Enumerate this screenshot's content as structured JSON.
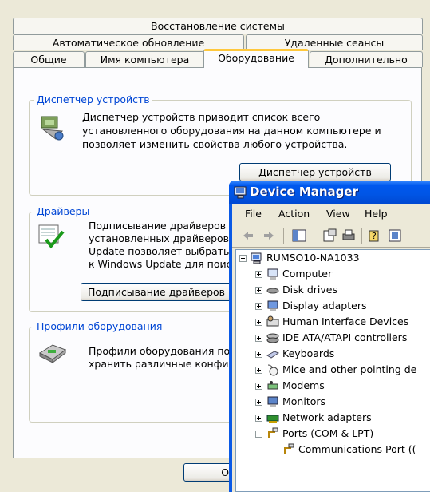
{
  "tabs_row1": [
    "Восстановление системы"
  ],
  "tabs_row2": [
    "Автоматическое обновление",
    "Удаленные сеансы"
  ],
  "tabs_row3": [
    "Общие",
    "Имя компьютера",
    "Оборудование",
    "Дополнительно"
  ],
  "device_manager_group": {
    "title": "Диспетчер устройств",
    "description": [
      "Диспетчер устройств приводит список всего",
      "установленного оборудования на данном компьютере и",
      "позволяет изменить свойства любого устройства."
    ],
    "button": "Диспетчер устройств"
  },
  "drivers_group": {
    "title": "Драйверы",
    "description": [
      "Подписывание драйверов с",
      "установленных драйверов с",
      "Update позволяет выбрать",
      "к Windows Update для поис"
    ],
    "button": "Подписывание драйверов"
  },
  "profiles_group": {
    "title": "Профили оборудования",
    "description": [
      "Профили оборудования пом",
      "хранить различные конфиг"
    ]
  },
  "ok_button": "ОК",
  "device_manager_window": {
    "title": "Device Manager",
    "menu": [
      "File",
      "Action",
      "View",
      "Help"
    ],
    "tree_root": "RUMSO10-NA1033",
    "tree_items": [
      "Computer",
      "Disk drives",
      "Display adapters",
      "Human Interface Devices",
      "IDE ATA/ATAPI controllers",
      "Keyboards",
      "Mice and other pointing de",
      "Modems",
      "Monitors",
      "Network adapters",
      "Ports (COM & LPT)"
    ],
    "tree_child": "Communications Port (("
  }
}
